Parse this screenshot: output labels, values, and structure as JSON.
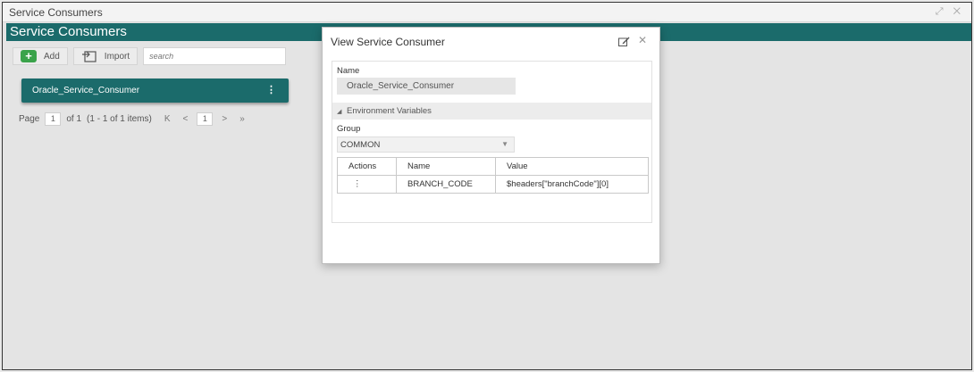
{
  "window": {
    "title": "Service Consumers",
    "controls": "⤢ ✕"
  },
  "page": {
    "header_title": "Service Consumers"
  },
  "toolbar": {
    "add_label": "Add",
    "import_label": "Import",
    "search_placeholder": "search",
    "add_icon": "+"
  },
  "cards": [
    {
      "title": "Oracle_Service_Consumer",
      "menu_glyph": "⋮"
    }
  ],
  "pager": {
    "page_label": "Page",
    "current_page": "1",
    "of_label": "of 1",
    "items_label": "(1 - 1 of 1 items)",
    "first": "K",
    "prev": "<",
    "page_button": "1",
    "next": ">",
    "last": "»"
  },
  "modal": {
    "title": "View Service Consumer",
    "close_glyph": "✕",
    "name_label": "Name",
    "name_value": "Oracle_Service_Consumer",
    "section_label": "Environment Variables",
    "section_toggle": "◢",
    "group_label": "Group",
    "group_value": "COMMON",
    "group_arrow": "▼",
    "table": {
      "headers": [
        "Actions",
        "Name",
        "Value"
      ],
      "rows": [
        {
          "action": "⋮",
          "name": "BRANCH_CODE",
          "value": "$headers[\"branchCode\"][0]"
        }
      ]
    }
  },
  "colors": {
    "accent": "#1b6b6b",
    "add_icon": "#3aa34a"
  }
}
